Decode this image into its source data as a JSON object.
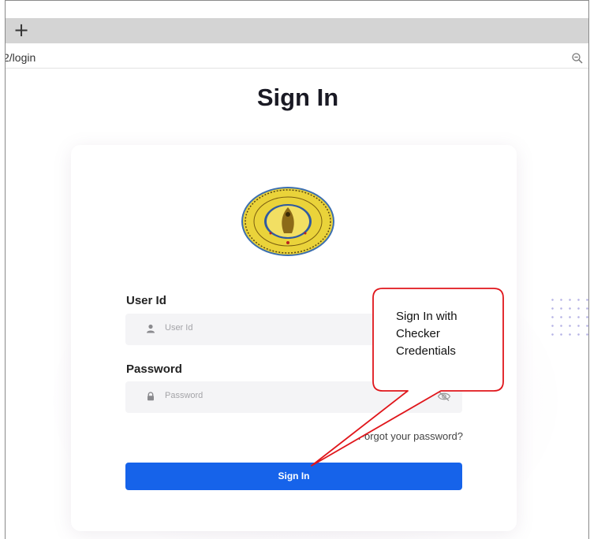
{
  "browser": {
    "new_tab_glyph": "+",
    "url": "2/login",
    "zoom_icon": "zoom-out-icon"
  },
  "page": {
    "title": "Sign In",
    "logo_icon": "board-seal-logo"
  },
  "form": {
    "user_id_label": "User Id",
    "user_id_placeholder": "User Id",
    "user_icon": "user-icon",
    "password_label": "Password",
    "password_placeholder": "Password",
    "lock_icon": "lock-icon",
    "eye_icon": "eye-off-icon",
    "forgot_link": "Forgot your password?",
    "submit_label": "Sign In"
  },
  "annotation": {
    "callout_text": "Sign In with Checker Credentials",
    "accent": "#e0161b"
  },
  "colors": {
    "primary": "#1663ea",
    "field_bg": "#f4f4f6"
  }
}
